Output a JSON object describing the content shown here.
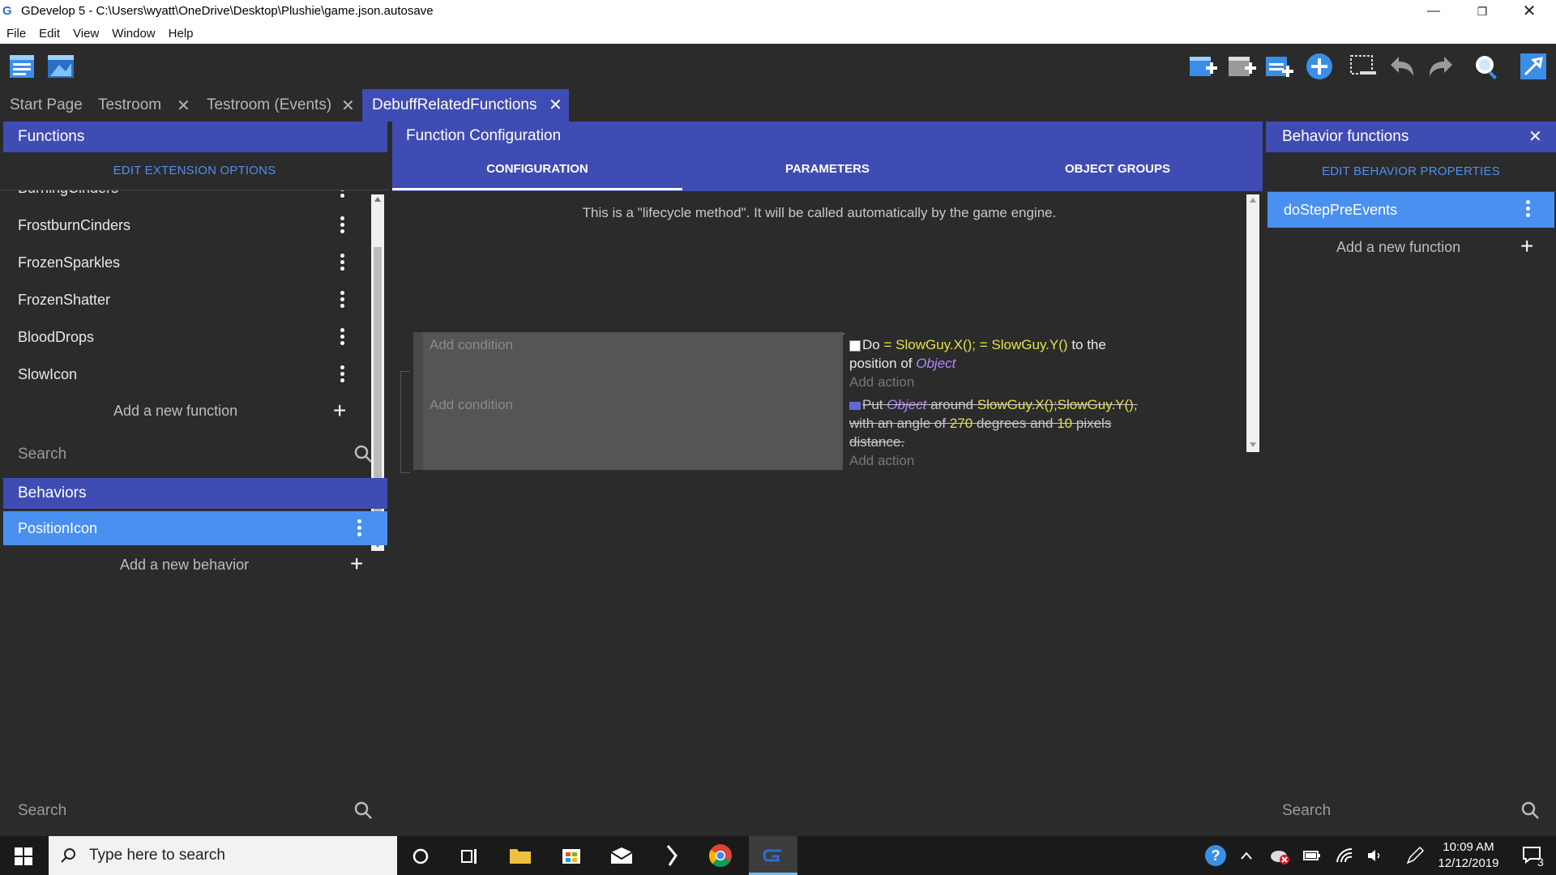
{
  "window": {
    "title": "GDevelop 5 - C:\\Users\\wyatt\\OneDrive\\Desktop\\Plushie\\game.json.autosave"
  },
  "menu": {
    "items": [
      "File",
      "Edit",
      "View",
      "Window",
      "Help"
    ]
  },
  "tabs": [
    {
      "label": "Start Page"
    },
    {
      "label": "Testroom"
    },
    {
      "label": "Testroom (Events)"
    },
    {
      "label": "DebuffRelatedFunctions"
    }
  ],
  "left": {
    "functions_title": "Functions",
    "edit_extension_label": "EDIT EXTENSION OPTIONS",
    "partial_item": "BurningCinders",
    "functions": [
      "FrostburnCinders",
      "FrozenSparkles",
      "FrozenShatter",
      "BloodDrops",
      "SlowIcon"
    ],
    "add_function_label": "Add a new function",
    "search_placeholder": "Search",
    "behaviors_title": "Behaviors",
    "behaviors": [
      "PositionIcon"
    ],
    "add_behavior_label": "Add a new behavior",
    "bottom_search_placeholder": "Search"
  },
  "center": {
    "title": "Function Configuration",
    "tabs": [
      "CONFIGURATION",
      "PARAMETERS",
      "OBJECT GROUPS"
    ],
    "lifecycle_text": "This is a \"lifecycle method\". It will be called automatically by the game engine.",
    "events": [
      {
        "condition_placeholder": "Add condition",
        "action": {
          "prefix": "Do",
          "op1": "=",
          "x": "SlowGuy.X();",
          "op2": "=",
          "y": "SlowGuy.Y()",
          "mid": "to the position of",
          "obj": "Object"
        },
        "add_action": "Add action"
      },
      {
        "condition_placeholder": "Add condition",
        "action": {
          "put": "Put",
          "obj": "Object",
          "around": "around",
          "coords": "SlowGuy.X();SlowGuy.Y()",
          "angle_text": ", with an angle of",
          "angle": "270",
          "deg_text": "degrees and",
          "dist": "10",
          "px_text": "pixels distance."
        },
        "add_action": "Add action"
      }
    ]
  },
  "right": {
    "title": "Behavior functions",
    "edit_label": "EDIT BEHAVIOR PROPERTIES",
    "functions": [
      "doStepPreEvents"
    ],
    "add_function_label": "Add a new function",
    "search_placeholder": "Search"
  },
  "taskbar": {
    "search_placeholder": "Type here to search",
    "time": "10:09 AM",
    "date": "12/12/2019",
    "notification_count": "3"
  },
  "colors": {
    "accent": "#3f4cb3",
    "selected": "#4a90f0",
    "link": "#4f8ff0",
    "expression": "#e6e04a",
    "object": "#b388ff"
  }
}
